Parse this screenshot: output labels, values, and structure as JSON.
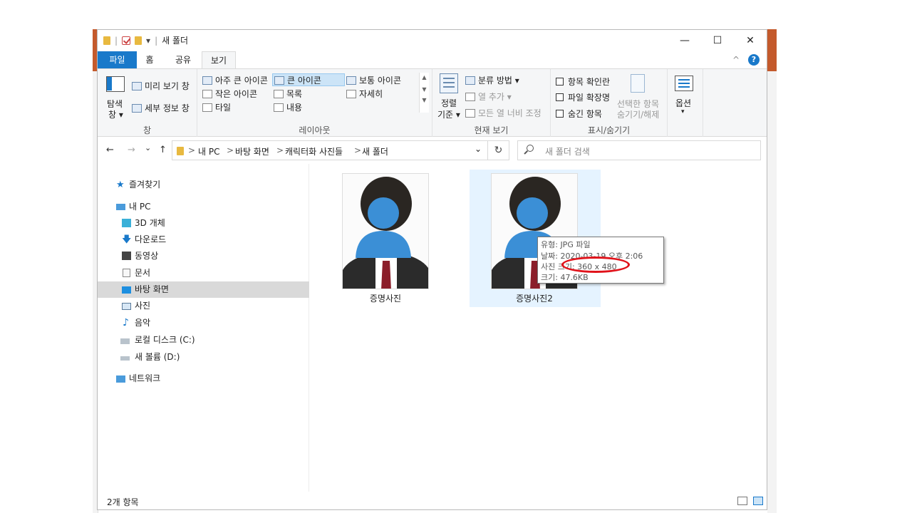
{
  "window": {
    "title": "새 폴더",
    "separator": "|",
    "qat_dropdown": "▾",
    "minimize": "—",
    "maximize": "☐",
    "close": "✕"
  },
  "tabs": [
    {
      "label": "파일"
    },
    {
      "label": "홈"
    },
    {
      "label": "공유"
    },
    {
      "label": "보기"
    }
  ],
  "help": {
    "label": "?",
    "collapse": "^"
  },
  "ribbon": {
    "pane_group": {
      "nav_pane": "탐색",
      "nav_pane2": "창 ▾",
      "preview": "미리 보기 창",
      "details": "세부 정보 창",
      "label": "창"
    },
    "layout_group": {
      "items": [
        "아주 큰 아이콘",
        "큰 아이콘",
        "보통 아이콘",
        "작은 아이콘",
        "목록",
        "자세히",
        "타일",
        "내용"
      ],
      "label": "레이아웃"
    },
    "current_view_group": {
      "sort": "정렬",
      "sort2": "기준 ▾",
      "group_by": "분류 방법 ▾",
      "add_columns": "열 추가 ▾",
      "fit_columns": "모든 열 너비 조정",
      "label": "현재 보기"
    },
    "showhide_group": {
      "checkboxes": "항목 확인란",
      "extensions": "파일 확장명",
      "hidden": "숨긴 항목",
      "hide_selected": "선택한 항목",
      "hide_selected2": "숨기기/해제",
      "label": "표시/숨기기"
    },
    "options": {
      "label": "옵션",
      "arrow": "▾"
    }
  },
  "address": {
    "back": "←",
    "forward": "→",
    "recent": "⌄",
    "up": "↑",
    "crumbs": [
      "내 PC",
      "바탕 화면",
      "캐릭터화 사진들",
      "새 폴더"
    ],
    "sep": ">",
    "dropdown": "⌄",
    "refresh": "↻",
    "search_placeholder": "새 폴더 검색"
  },
  "nav": [
    {
      "label": "즐겨찾기"
    },
    {
      "label": "내 PC"
    },
    {
      "label": "3D 개체"
    },
    {
      "label": "다운로드"
    },
    {
      "label": "동영상"
    },
    {
      "label": "문서"
    },
    {
      "label": "바탕 화면"
    },
    {
      "label": "사진"
    },
    {
      "label": "음악"
    },
    {
      "label": "로컬 디스크 (C:)"
    },
    {
      "label": "새 볼륨 (D:)"
    },
    {
      "label": "네트워크"
    }
  ],
  "files": [
    {
      "name": "증명사진"
    },
    {
      "name": "증명사진2"
    }
  ],
  "tooltip": {
    "type": "유형: JPG 파일",
    "date": "날짜: 2020-03-19 오후 2:06",
    "dimensions": "사진 크기: 360 x 480",
    "size": "크기: 47.6KB"
  },
  "status": {
    "count": "2개 항목"
  },
  "colors": {
    "accent": "#1979ca",
    "avatar": "#3b8fd6",
    "highlight": "#e0121a",
    "suit": "#2b2b2b",
    "tie": "#8b1e2a"
  }
}
